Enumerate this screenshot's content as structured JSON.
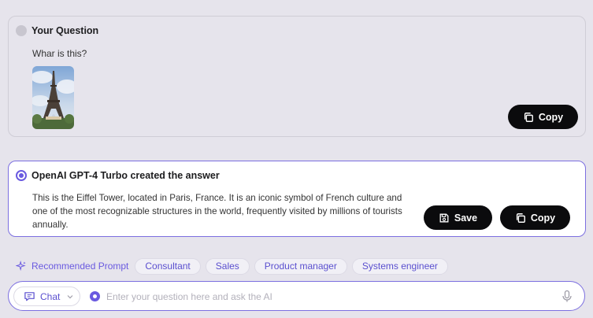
{
  "question": {
    "heading": "Your Question",
    "text": "Whar is this?",
    "image_subject": "Eiffel Tower photo",
    "copy_label": "Copy"
  },
  "answer": {
    "heading": "OpenAI GPT-4 Turbo created the answer",
    "text": "This is the Eiffel Tower, located in Paris, France. It is an iconic symbol of French culture and one of the most recognizable structures in the world, frequently visited by millions of tourists annually.",
    "save_label": "Save",
    "copy_label": "Copy"
  },
  "recommended": {
    "label": "Recommended Prompt",
    "chips": [
      "Consultant",
      "Sales",
      "Product manager",
      "Systems engineer"
    ]
  },
  "input": {
    "mode_label": "Chat",
    "placeholder": "Enter your question here and ask the AI",
    "value": ""
  },
  "colors": {
    "accent": "#6a5ae0",
    "background": "#e6e4ec",
    "button_dark": "#0b0b0d"
  }
}
